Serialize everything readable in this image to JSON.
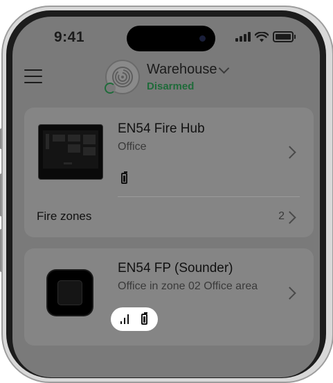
{
  "status_bar": {
    "time": "9:41"
  },
  "header": {
    "hub_name": "Warehouse",
    "hub_status": "Disarmed"
  },
  "devices": [
    {
      "name": "EN54 Fire Hub",
      "room": "Office",
      "zones_label": "Fire zones",
      "zones_count": "2"
    },
    {
      "name": "EN54 FP (Sounder)",
      "room": "Office in zone 02 Office area"
    }
  ],
  "colors": {
    "accent_green": "#1f6b3a",
    "overlay": "#7a7a7a"
  }
}
